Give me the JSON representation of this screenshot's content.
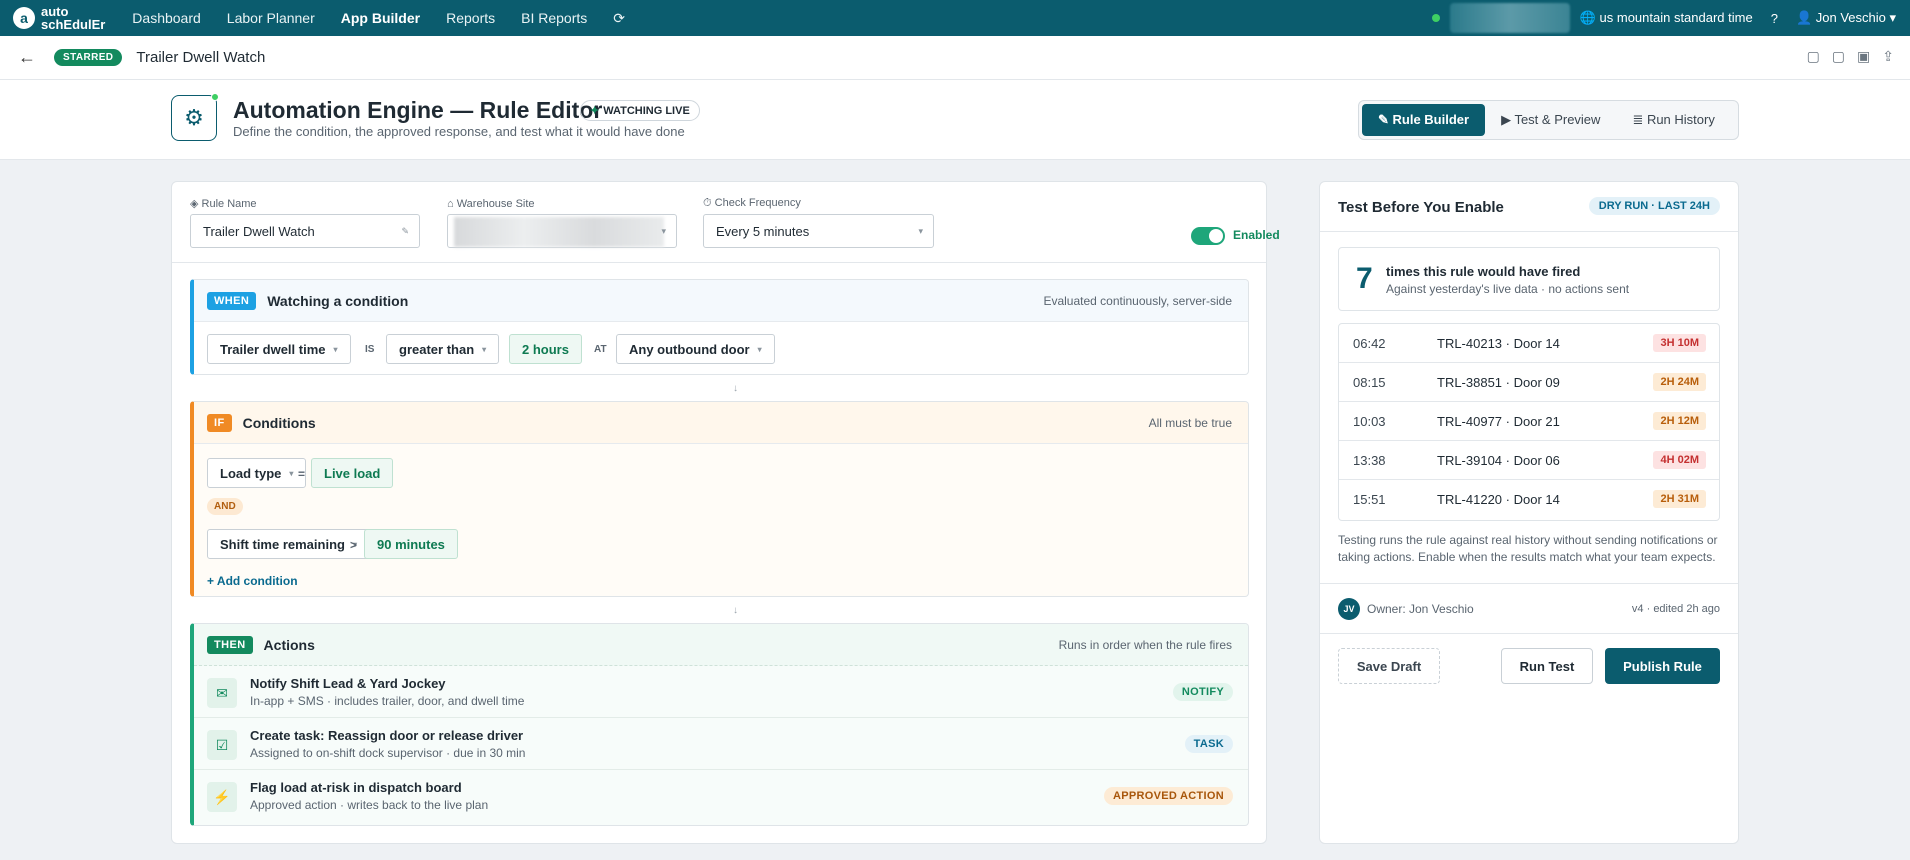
{
  "topnav": {
    "logo_letter": "a",
    "logo_line1": "auto",
    "logo_line2": "schEdulEr",
    "items": [
      "Dashboard",
      "Labor Planner",
      "App Builder",
      "Reports",
      "BI Reports"
    ],
    "refresh_icon": "refresh-icon",
    "timezone": "🌐 us mountain standard time",
    "help": "?",
    "user": "👤 Jon Veschio ▾"
  },
  "subheader": {
    "back": "←",
    "starred": "STARRED",
    "title": "Trailer Dwell Watch"
  },
  "header": {
    "title": "Automation Engine — Rule Editor",
    "watching": "WATCHING LIVE",
    "subtitle": "Define the condition, the approved response, and test what it would have done",
    "tabs": [
      "✎ Rule Builder",
      "▶ Test & Preview",
      "≣ Run History"
    ]
  },
  "fields": {
    "rule_name_label": "◈ Rule Name",
    "rule_name_value": "Trailer Dwell Watch",
    "site_label": "⌂ Warehouse Site",
    "frequency_label": "⏱ Check Frequency",
    "frequency_value": "Every 5 minutes",
    "enabled_label": "Enabled"
  },
  "when": {
    "tag": "WHEN",
    "title": "Watching a condition",
    "note": "Evaluated continuously, server-side",
    "metric": "Trailer dwell time",
    "is": "IS",
    "operator": "greater than",
    "value": "2 hours",
    "at": "AT",
    "location": "Any outbound door"
  },
  "if": {
    "tag": "IF",
    "title": "Conditions",
    "note": "All must be true",
    "cond1_field": "Load type",
    "cond1_op": "=",
    "cond1_value": "Live load",
    "and": "AND",
    "cond2_field": "Shift time remaining",
    "cond2_op": ">",
    "cond2_value": "90 minutes",
    "add": "+ Add condition"
  },
  "then": {
    "tag": "THEN",
    "title": "Actions",
    "note": "Runs in order when the rule fires",
    "actions": [
      {
        "title": "Notify Shift Lead & Yard Jockey",
        "sub": "In-app + SMS · includes trailer, door, and dwell time",
        "badge": "NOTIFY"
      },
      {
        "title": "Create task: Reassign door or release driver",
        "sub": "Assigned to on-shift dock supervisor · due in 30 min",
        "badge": "TASK"
      },
      {
        "title": "Flag load at-risk in dispatch board",
        "sub": "Approved action · writes back to the live plan",
        "badge": "APPROVED ACTION"
      }
    ]
  },
  "side": {
    "title": "Test Before You Enable",
    "badge": "DRY RUN · LAST 24H",
    "count": "7",
    "count_title": "times this rule would have fired",
    "count_sub": "Against yesterday's live data · no actions sent",
    "events": [
      {
        "time": "06:42",
        "id": "TRL-40213 · Door 14",
        "dur": "3H 10M",
        "level": "red"
      },
      {
        "time": "08:15",
        "id": "TRL-38851 · Door 09",
        "dur": "2H 24M",
        "level": "orange"
      },
      {
        "time": "10:03",
        "id": "TRL-40977 · Door 21",
        "dur": "2H 12M",
        "level": "orange"
      },
      {
        "time": "13:38",
        "id": "TRL-39104 · Door 06",
        "dur": "4H 02M",
        "level": "red"
      },
      {
        "time": "15:51",
        "id": "TRL-41220 · Door 14",
        "dur": "2H 31M",
        "level": "orange"
      }
    ],
    "note": "Testing runs the rule against real history without sending notifications or taking actions. Enable when the results match what your team expects.",
    "avatar": "JV",
    "owner": "Owner: Jon Veschio",
    "version": "v4 · edited 2h ago",
    "save": "Save Draft",
    "run": "Run Test",
    "publish": "Publish Rule"
  }
}
